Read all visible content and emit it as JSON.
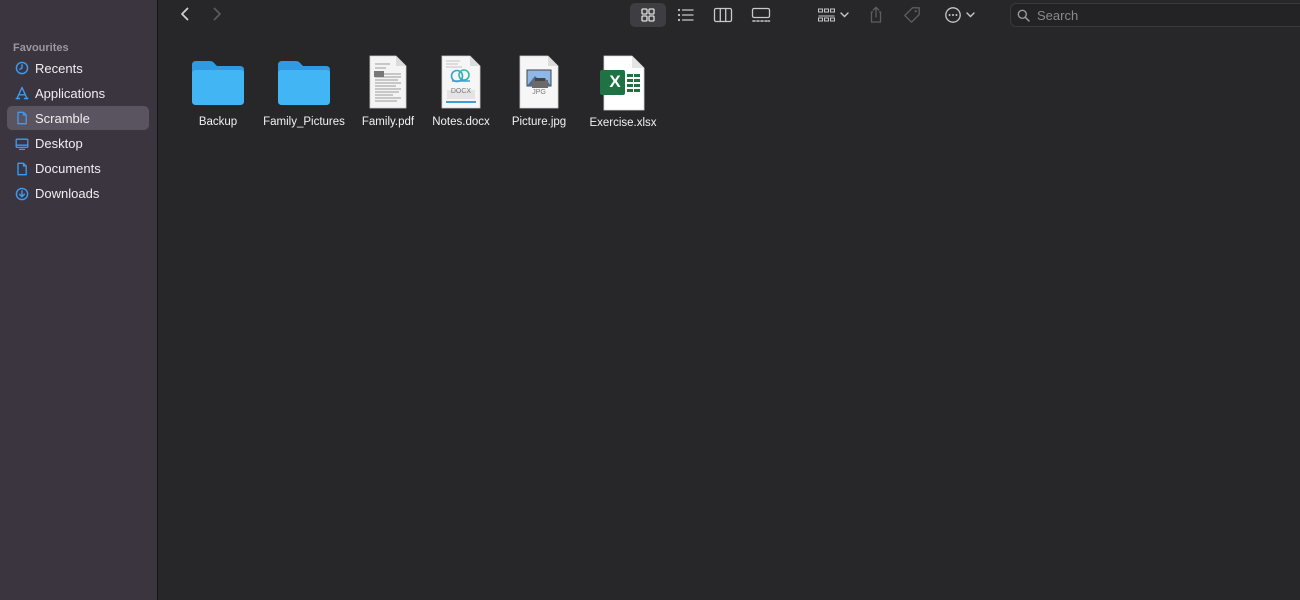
{
  "sidebar": {
    "heading": "Favourites",
    "items": [
      {
        "label": "Recents",
        "icon": "clock-icon"
      },
      {
        "label": "Applications",
        "icon": "applications-icon"
      },
      {
        "label": "Scramble",
        "icon": "document-icon"
      },
      {
        "label": "Desktop",
        "icon": "desktop-icon"
      },
      {
        "label": "Documents",
        "icon": "document-icon"
      },
      {
        "label": "Downloads",
        "icon": "download-icon"
      }
    ],
    "selected": "Scramble"
  },
  "toolbar": {
    "view_mode": "icon-view",
    "search_placeholder": "Search"
  },
  "files": [
    {
      "name": "Backup",
      "type": "folder"
    },
    {
      "name": "Family_Pictures",
      "type": "folder"
    },
    {
      "name": "Family.pdf",
      "type": "pdf"
    },
    {
      "name": "Notes.docx",
      "type": "docx",
      "badge": "DOCX"
    },
    {
      "name": "Picture.jpg",
      "type": "jpg",
      "badge": "JPG"
    },
    {
      "name": "Exercise.xlsx",
      "type": "xlsx",
      "badge": "X"
    }
  ],
  "colors": {
    "accent": "#3b9cf5",
    "folder": "#3fb1f1",
    "excel": "#1f7244"
  }
}
